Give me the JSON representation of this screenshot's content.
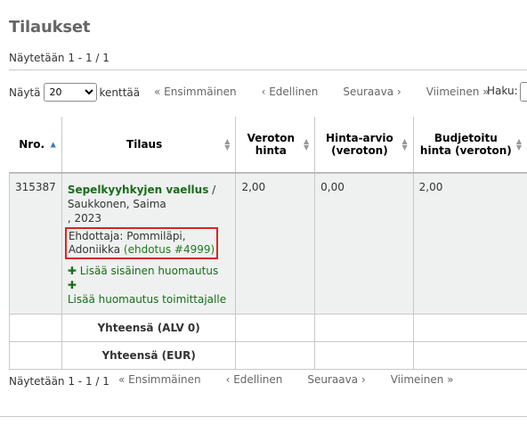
{
  "page": {
    "title": "Tilaukset",
    "info_top": "Näytetään 1 - 1 / 1",
    "info_bottom": "Näytetään 1 - 1 / 1"
  },
  "controls": {
    "show_label": "Näytä",
    "show_value": "20",
    "show_suffix": "kenttää",
    "search_label": "Haku:"
  },
  "pager": {
    "first": "« Ensimmäinen",
    "prev": "‹ Edellinen",
    "next": "Seuraava ›",
    "last": "Viimeinen »"
  },
  "table": {
    "headers": {
      "nro": "Nro.",
      "tilaus": "Tilaus",
      "veroton1": "Veroton",
      "veroton2": "hinta",
      "arvio1": "Hinta-arvio",
      "arvio2": "(veroton)",
      "budjetoitu1": "Budjetoitu",
      "budjetoitu2": "hinta (veroton)"
    },
    "row": {
      "nro": "315387",
      "title": "Sepelkyyhkyjen vaellus",
      "title_sep": " /",
      "author": "Saukkonen, Saima",
      "year": ", 2023",
      "proposer_prefix": "Ehdottaja: Pommiläpi,",
      "proposer_name": "Adoniikka",
      "proposer_link": "(ehdotus #4999)",
      "internal_note": "Lisää sisäinen huomautus",
      "vendor_note": "Lisää huomautus toimittajalle",
      "price": "2,00",
      "estimate": "0,00",
      "budget": "2,00"
    },
    "totals": {
      "vat0": "Yhteensä (ALV 0)",
      "eur": "Yhteensä (EUR)"
    }
  },
  "colors": {
    "link_green": "#1a6b1a",
    "highlight_red": "#d9261c",
    "row_bg": "#eef1ef"
  }
}
